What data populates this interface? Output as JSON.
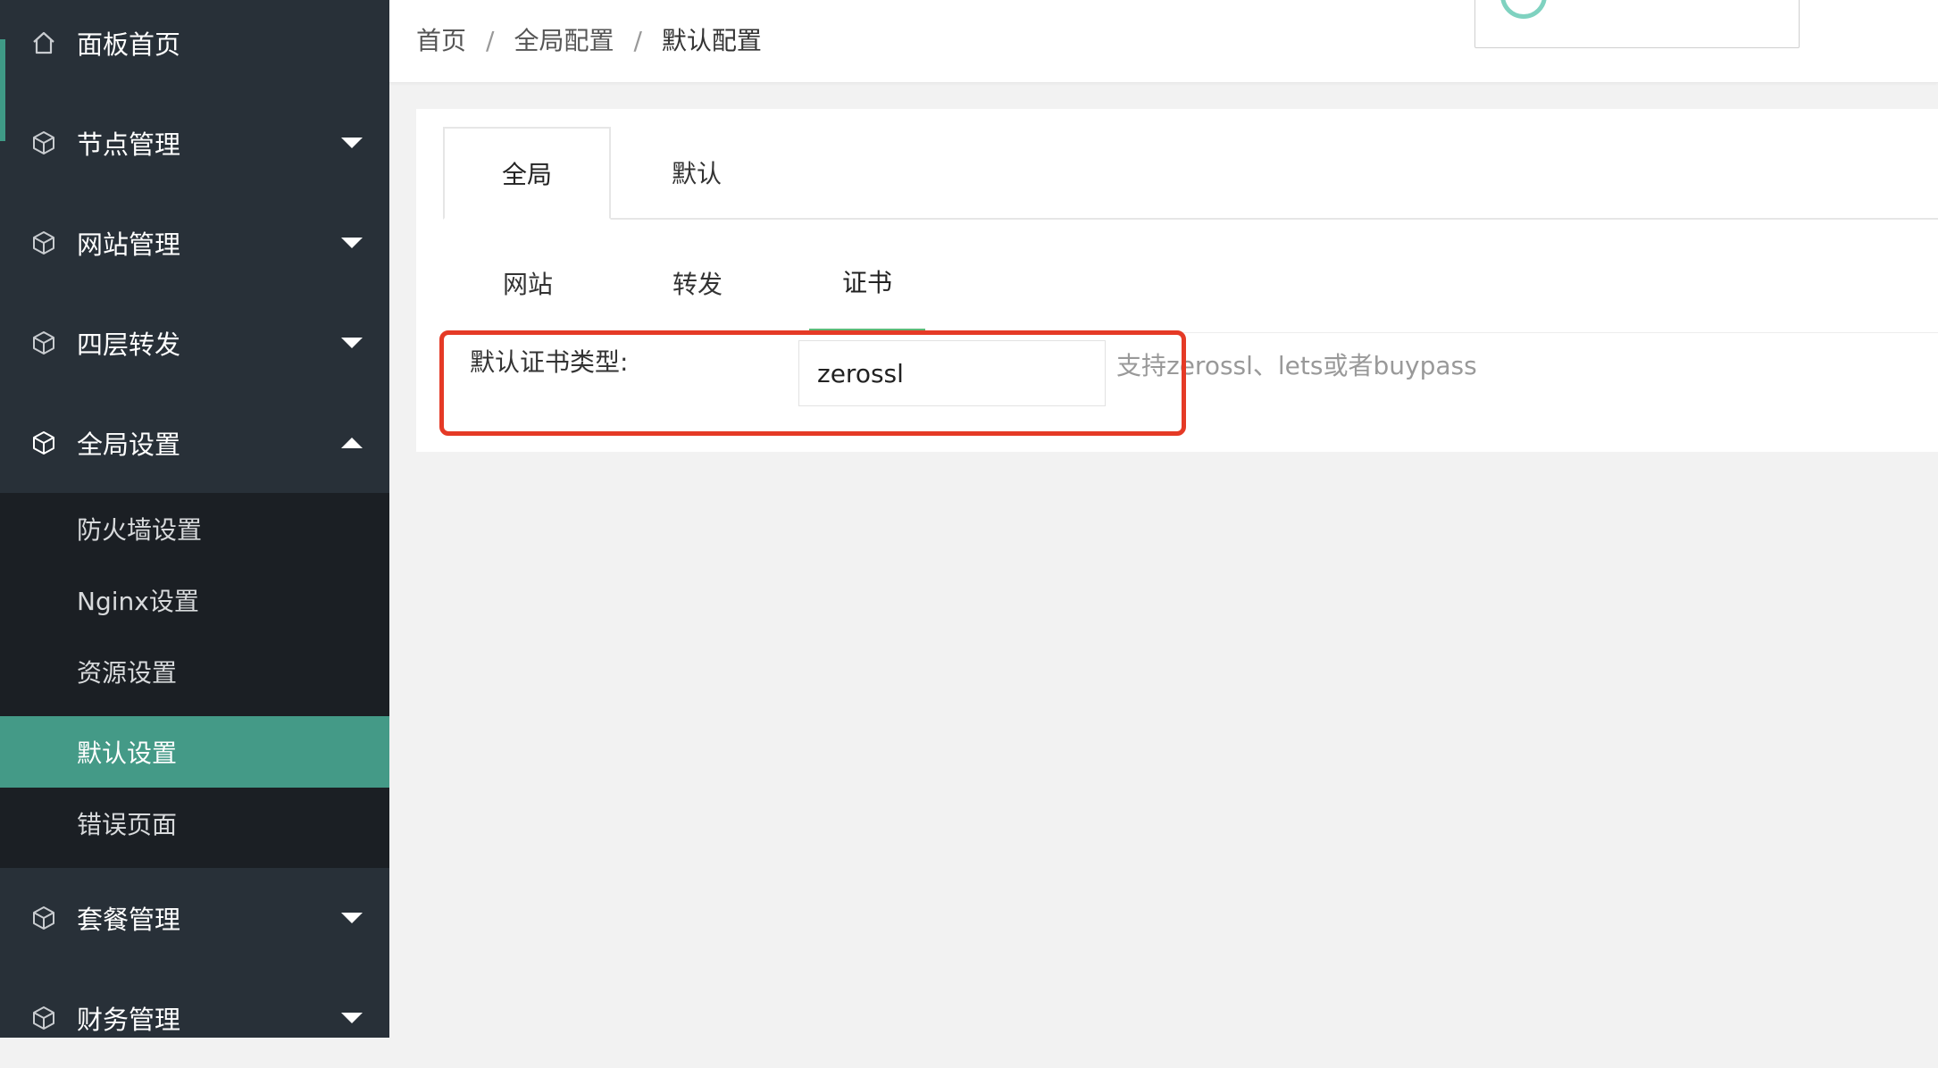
{
  "sidebar": {
    "items": [
      {
        "label": "面板首页",
        "icon": "home-icon"
      },
      {
        "label": "节点管理",
        "icon": "cube-icon",
        "caret": "down"
      },
      {
        "label": "网站管理",
        "icon": "cube-icon",
        "caret": "down"
      },
      {
        "label": "四层转发",
        "icon": "cube-icon",
        "caret": "down"
      },
      {
        "label": "全局设置",
        "icon": "cube-icon",
        "caret": "up"
      },
      {
        "label": "套餐管理",
        "icon": "cube-icon",
        "caret": "down"
      },
      {
        "label": "财务管理",
        "icon": "cube-icon",
        "caret": "down"
      }
    ],
    "submenu": [
      {
        "label": "防火墙设置"
      },
      {
        "label": "Nginx设置"
      },
      {
        "label": "资源设置"
      },
      {
        "label": "默认设置",
        "active": true
      },
      {
        "label": "错误页面"
      }
    ],
    "colors": {
      "background": "#283038",
      "submenu_background": "#1b1f24",
      "active": "#449a87"
    }
  },
  "breadcrumb": {
    "items": [
      "首页",
      "全局配置",
      "默认配置"
    ],
    "separator": "/"
  },
  "tabs_primary": [
    {
      "label": "全局",
      "active": true
    },
    {
      "label": "默认",
      "active": false
    }
  ],
  "tabs_secondary": [
    {
      "label": "网站",
      "active": false
    },
    {
      "label": "转发",
      "active": false
    },
    {
      "label": "证书",
      "active": true
    }
  ],
  "form": {
    "cert_type_label": "默认证书类型:",
    "cert_type_value": "zerossl",
    "cert_type_hint": "支持zerossl、lets或者buypass"
  },
  "colors": {
    "highlight_border": "#e53a26",
    "tab_underline": "#5fb878"
  }
}
